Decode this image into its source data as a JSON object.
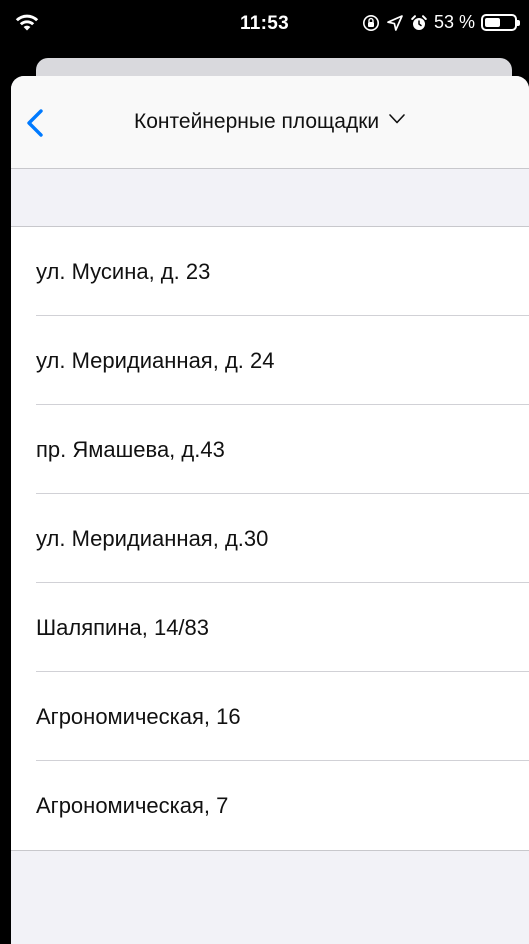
{
  "status_bar": {
    "time": "11:53",
    "battery_text": "53 %",
    "battery_level": 0.53,
    "icons": [
      "wifi-icon",
      "orientation-lock-icon",
      "location-icon",
      "alarm-icon",
      "battery-icon"
    ]
  },
  "nav": {
    "title": "Контейнерные площадки",
    "back_icon": "chevron-left-icon",
    "title_icon": "chevron-down-icon",
    "accent_color": "#007aff"
  },
  "list": {
    "items": [
      {
        "label": "ул. Мусина, д. 23"
      },
      {
        "label": "ул. Меридианная, д. 24"
      },
      {
        "label": "пр. Ямашева, д.43"
      },
      {
        "label": "ул. Меридианная, д.30"
      },
      {
        "label": "Шаляпина, 14/83"
      },
      {
        "label": "Агрономическая, 16"
      },
      {
        "label": "Агрономическая, 7"
      }
    ]
  }
}
